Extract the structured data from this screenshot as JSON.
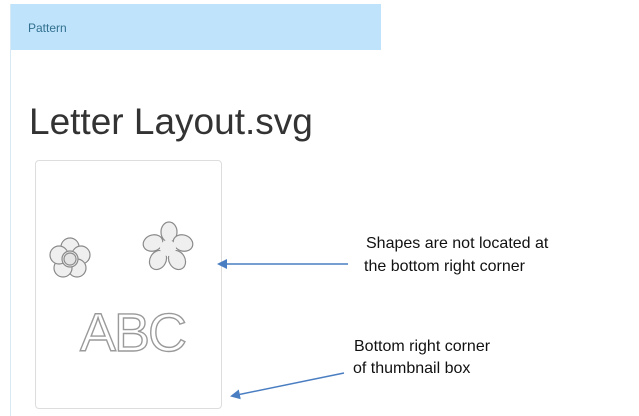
{
  "panel": {
    "header_label": "Pattern"
  },
  "file": {
    "title": "Letter Layout.svg"
  },
  "thumbnail": {
    "text": "ABC",
    "shapes": [
      "flower-icon",
      "flower-icon"
    ]
  },
  "annotations": {
    "shapes_note": {
      "line1": "Shapes are not located at",
      "line2": "the bottom right corner"
    },
    "corner_note": {
      "line1": "Bottom right corner",
      "line2": "of thumbnail box"
    }
  },
  "colors": {
    "header_bg": "#bfe3fb",
    "header_text": "#31708f",
    "arrow": "#4a7ec2"
  }
}
